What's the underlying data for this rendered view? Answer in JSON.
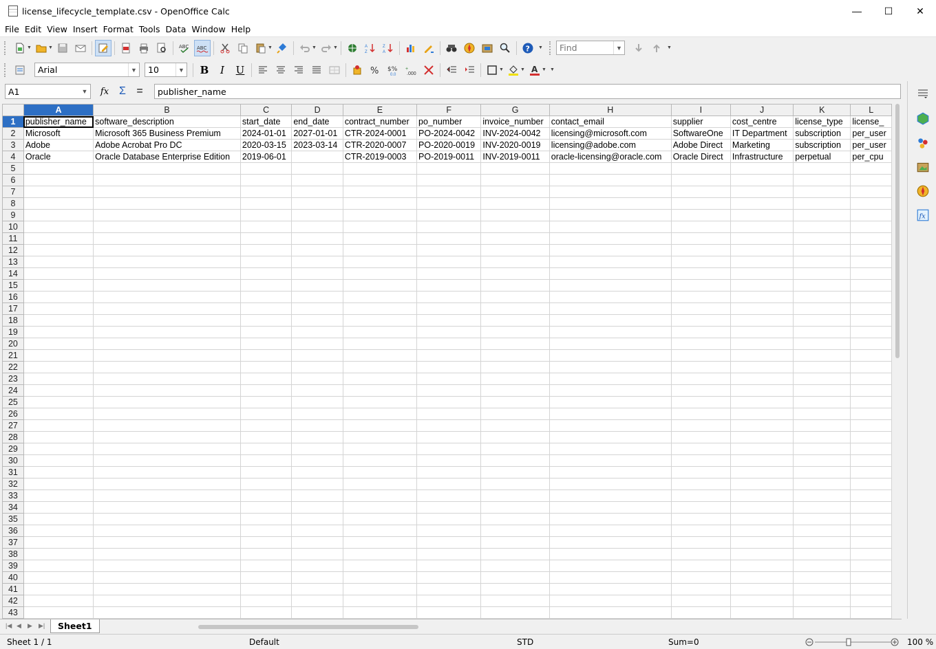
{
  "window": {
    "title": "license_lifecycle_template.csv - OpenOffice Calc",
    "minimize": "—",
    "maximize": "☐",
    "close": "✕"
  },
  "menu": [
    "File",
    "Edit",
    "View",
    "Insert",
    "Format",
    "Tools",
    "Data",
    "Window",
    "Help"
  ],
  "toolbar": {
    "find_placeholder": "Find",
    "font_name": "Arial",
    "font_size": "10",
    "bold": "B",
    "italic": "I",
    "underline": "U"
  },
  "formula_bar": {
    "cell_ref": "A1",
    "content": "publisher_name",
    "fx": "fx",
    "sum": "Σ",
    "equals": "="
  },
  "sheet": {
    "columns": [
      "A",
      "B",
      "C",
      "D",
      "E",
      "F",
      "G",
      "H",
      "I",
      "J",
      "K",
      "L"
    ],
    "rows": [
      [
        "publisher_name",
        "software_description",
        "start_date",
        "end_date",
        "contract_number",
        "po_number",
        "invoice_number",
        "contact_email",
        "supplier",
        "cost_centre",
        "license_type",
        "license_"
      ],
      [
        "Microsoft",
        "Microsoft 365 Business Premium",
        "2024-01-01",
        "2027-01-01",
        "CTR-2024-0001",
        "PO-2024-0042",
        "INV-2024-0042",
        "licensing@microsoft.com",
        "SoftwareOne",
        "IT Department",
        "subscription",
        "per_user"
      ],
      [
        "Adobe",
        "Adobe Acrobat Pro DC",
        "2020-03-15",
        "2023-03-14",
        "CTR-2020-0007",
        "PO-2020-0019",
        "INV-2020-0019",
        "licensing@adobe.com",
        "Adobe Direct",
        "Marketing",
        "subscription",
        "per_user"
      ],
      [
        "Oracle",
        "Oracle Database Enterprise Edition",
        "2019-06-01",
        "",
        "CTR-2019-0003",
        "PO-2019-0011",
        "INV-2019-0011",
        "oracle-licensing@oracle.com",
        "Oracle Direct",
        "Infrastructure",
        "perpetual",
        "per_cpu"
      ]
    ],
    "total_rows": 43,
    "tab_name": "Sheet1"
  },
  "status": {
    "sheet": "Sheet 1 / 1",
    "style": "Default",
    "mode": "STD",
    "sum": "Sum=0",
    "zoom": "100 %"
  }
}
